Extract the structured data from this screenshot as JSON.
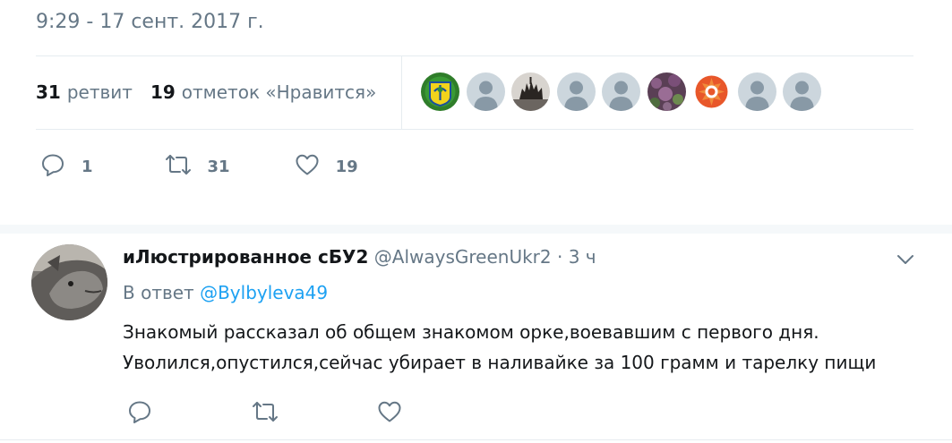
{
  "tweet": {
    "timestamp": "9:29 - 17 сент. 2017 г.",
    "stats": {
      "retweets_count": "31",
      "retweets_label": "ретвит",
      "likes_count": "19",
      "likes_label": "отметок «Нравится»"
    },
    "liked_by_avatars": [
      "avatar-green-emblem",
      "avatar-default",
      "avatar-monument",
      "avatar-default",
      "avatar-default",
      "avatar-purple-flowers",
      "avatar-orange-emblem",
      "avatar-default",
      "avatar-default"
    ],
    "actions": {
      "reply_count": "1",
      "retweet_count": "31",
      "like_count": "19"
    }
  },
  "reply": {
    "fullname": "иЛюстрированное сБУ2",
    "handle": "@AlwaysGreenUkr2",
    "separator": " · ",
    "time": "3 ч",
    "reply_prefix": "В ответ",
    "reply_to_handle": "@Bylbyleva49",
    "text_line1": "Знакомый рассказал об общем знакомом орке,воевавшим с первого дня.",
    "text_line2": "Уволился,опустился,сейчас убирает в наливайке за 100 грамм и тарелку пищи"
  },
  "colors": {
    "text_primary": "#14171a",
    "text_secondary": "#657786",
    "link": "#1da1f2",
    "divider": "#e6ecf0",
    "background_alt": "#f5f8fa",
    "default_avatar": "#ccd6dd"
  }
}
